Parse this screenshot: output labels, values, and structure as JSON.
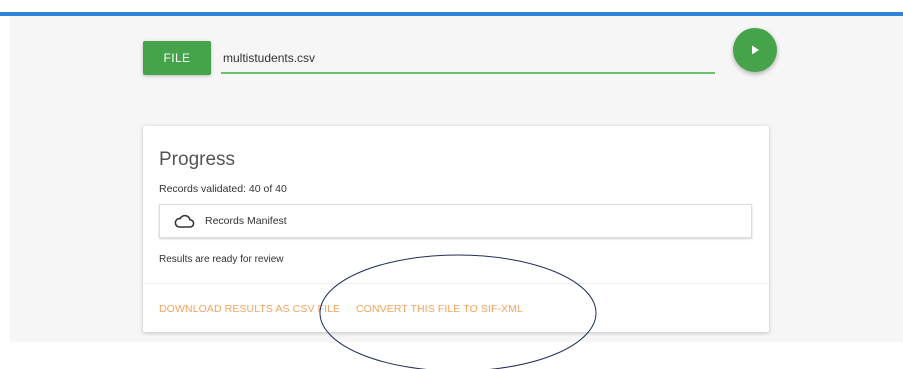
{
  "file_picker": {
    "button_label": "FILE",
    "filename": "multistudents.csv"
  },
  "run_button": {
    "icon": "play-icon"
  },
  "progress_card": {
    "title": "Progress",
    "records_validated": "Records validated: 40 of 40",
    "manifest": {
      "icon": "cloud-icon",
      "label": "Records Manifest"
    },
    "results_status": "Results are ready for review",
    "actions": [
      {
        "label": "DOWNLOAD RESULTS AS CSV FILE"
      },
      {
        "label": "CONVERT THIS FILE TO SIF-XML"
      }
    ]
  },
  "colors": {
    "top_bar": "#2f86d9",
    "primary_green": "#45a44a",
    "input_underline": "#6bc06f",
    "action_link": "#f5a35f"
  }
}
